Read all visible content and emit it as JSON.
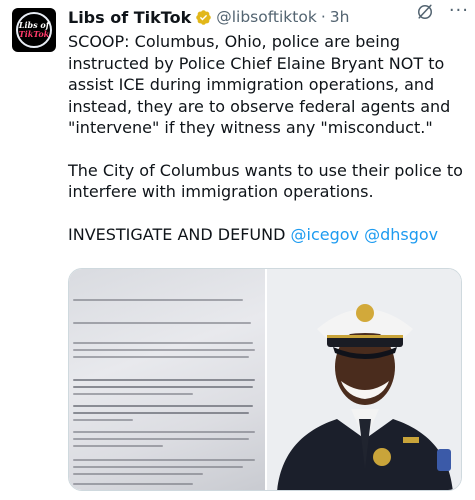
{
  "account": {
    "display_name": "Libs of TikTok",
    "handle": "@libsoftiktok",
    "separator": "·",
    "time": "3h",
    "avatar_line1": "Libs of",
    "avatar_line2": "TikTok"
  },
  "tweet": {
    "paragraph1": "SCOOP: Columbus, Ohio, police are being instructed by Police Chief Elaine Bryant NOT to assist ICE during immigration operations, and instead, they are to observe federal agents and \"intervene\" if they witness any \"misconduct.\"",
    "paragraph2": "The City of Columbus wants to use their police to interfere with immigration operations.",
    "paragraph3_text": "INVESTIGATE AND DEFUND ",
    "mention1": "@icegov",
    "mention2": "@dhsgov"
  },
  "colors": {
    "link": "#1d9bf0",
    "verified_badge": "#e2b719",
    "text": "#0f1419",
    "secondary": "#536471"
  },
  "icons": [
    "verified-badge-icon",
    "grok-icon",
    "more-options-icon"
  ]
}
